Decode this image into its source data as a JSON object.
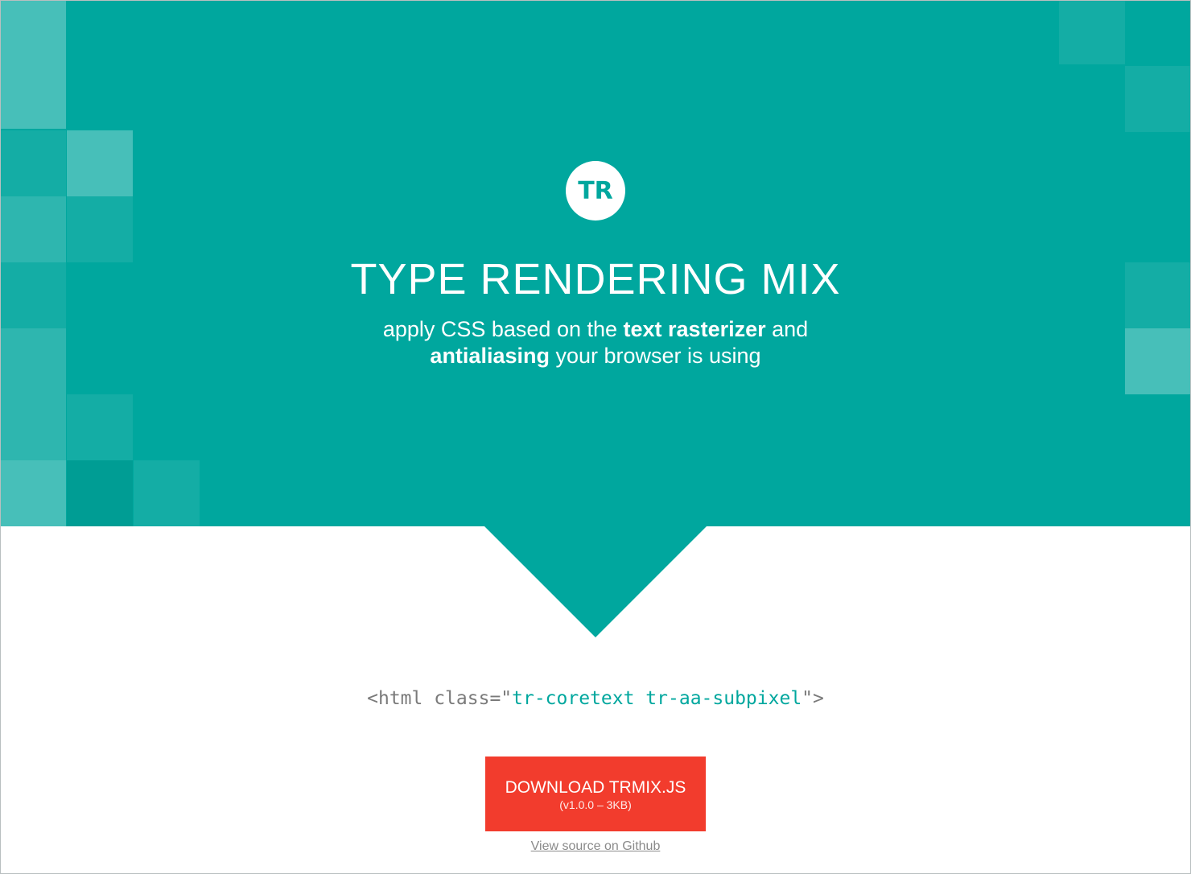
{
  "hero": {
    "logo_text": "TR",
    "title": "TYPE RENDERING MIX",
    "tagline": {
      "part1": "apply CSS based on the ",
      "bold1": "text rasterizer",
      "part2": " and",
      "bold2": "antialiasing",
      "part3": " your browser is using"
    }
  },
  "code": {
    "prefix": "<html class=\"",
    "classes": "tr-coretext tr-aa-subpixel",
    "suffix": "\">"
  },
  "download": {
    "label": "DOWNLOAD TRMIX.JS",
    "meta": "(v1.0.0 – 3KB)"
  },
  "source": {
    "label": "View source on Github"
  },
  "colors": {
    "brand_teal": "#00a79e",
    "download_red": "#f23c2d"
  }
}
